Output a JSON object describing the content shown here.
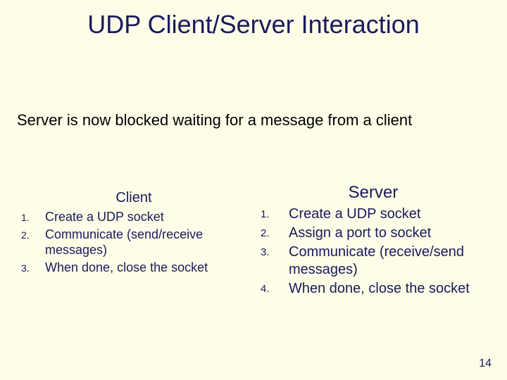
{
  "title": "UDP Client/Server Interaction",
  "subtitle": "Server is now blocked waiting for a message from a client",
  "client": {
    "heading": "Client",
    "items": [
      {
        "n": "1.",
        "t": "Create a UDP socket"
      },
      {
        "n": "2.",
        "t": "Communicate (send/receive messages)"
      },
      {
        "n": "3.",
        "t": "When done, close the socket"
      }
    ]
  },
  "server": {
    "heading": "Server",
    "items": [
      {
        "n": "1.",
        "t": "Create a UDP socket"
      },
      {
        "n": "2.",
        "t": "Assign a port to socket"
      },
      {
        "n": "3.",
        "t": "Communicate (receive/send messages)"
      },
      {
        "n": "4.",
        "t": "When done, close the socket"
      }
    ]
  },
  "pageNumber": "14"
}
